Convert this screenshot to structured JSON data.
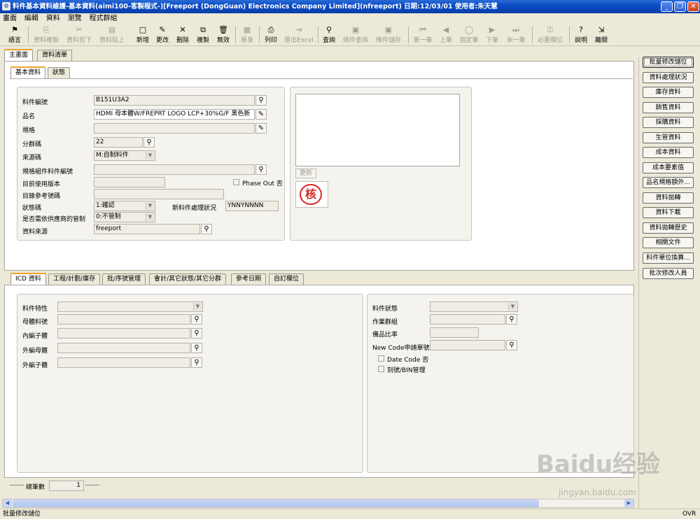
{
  "window": {
    "title": "料件基本資料維護-基本資料(aimi100-客製程式-)[Freeport (DongGuan) Electronics Company Limited](nfreeport)  日期:12/03/01  使用者:朱天慧"
  },
  "menu": [
    "畫面",
    "編輯",
    "資料",
    "瀏覽",
    "程式群組"
  ],
  "toolbar": {
    "lang": "語言",
    "copy": "資料複製",
    "cut": "資料剪下",
    "paste": "資料貼上",
    "new": "新增",
    "modify": "更改",
    "delete": "刪除",
    "duplicate": "複製",
    "invalid": "無效",
    "single": "單身",
    "print": "列印",
    "export": "匯出Excel",
    "query": "查詢",
    "cond_query": "條件查詢",
    "cond_save": "條件儲存",
    "first": "第一筆",
    "prev": "上筆",
    "goto": "指定筆",
    "next": "下筆",
    "last": "末一筆",
    "required": "必要欄位",
    "help": "說明",
    "exit": "離開"
  },
  "main_tabs": [
    "主畫面",
    "資料清單"
  ],
  "sub_tabs": [
    "基本資料",
    "狀態"
  ],
  "form": {
    "part_no_label": "料件編號",
    "part_no": "B151U3A2",
    "name_label": "品名",
    "name": "HDMI   母本體W/FREPRT   LOGO   LCP+30%G/F   黑色新",
    "spec_label": "規格",
    "spec": "",
    "group_label": "分群碼",
    "group": "22",
    "source_label": "來源碼",
    "source": "M:自制料件",
    "spec_part_label": "規格組件料件編號",
    "spec_part": "",
    "cur_ver_label": "目前使用版本",
    "cur_ver": "",
    "phase_out_label": "Phase Out 否",
    "catalog_label": "目錄參考號碼",
    "catalog": "",
    "status_label": "狀態碼",
    "status": "1:確認",
    "new_status_label": "新料件處理狀況",
    "new_status": "YNNYNNNN",
    "vendor_ctrl_label": "是否需依供應商的管制",
    "vendor_ctrl": "0:不管制",
    "data_source_label": "資料來源",
    "data_source": "freeport",
    "update_btn": "更新",
    "stamp": "核"
  },
  "bottom_tabs": [
    "ICD 資料",
    "工程/計劃/庫存",
    "批/序號管理",
    "會計/其它狀態/其它分群",
    "參考日期",
    "自訂欄位"
  ],
  "icd": {
    "attr_label": "料件特性",
    "mother_label": "母體料號",
    "inner_child_label": "內編子體",
    "outer_mother_label": "外編母體",
    "outer_child_label": "外編子體",
    "part_status_label": "料件狀態",
    "work_group_label": "作業群組",
    "spare_label": "備品比率",
    "new_code_label": "New Code申請單號",
    "date_code_label": "Date Code 否",
    "bin_label": "刻號/BIN管理"
  },
  "total_label": "總筆數",
  "total_value": "1",
  "right_buttons": [
    "批量修改儲位",
    "資料處理狀況",
    "庫存資料",
    "銷售資料",
    "採購資料",
    "生管資料",
    "成本資料",
    "成本要素值",
    "品名規格額外...",
    "資料拋轉",
    "資料下載",
    "資料拋轉歷史",
    "相關文件",
    "料件單位換算...",
    "批次修改人員"
  ],
  "statusbar": {
    "message": "批量修改儲位",
    "mode": "OVR"
  },
  "watermark": {
    "brand": "Baidu经验",
    "url": "jingyan.baidu.com"
  }
}
